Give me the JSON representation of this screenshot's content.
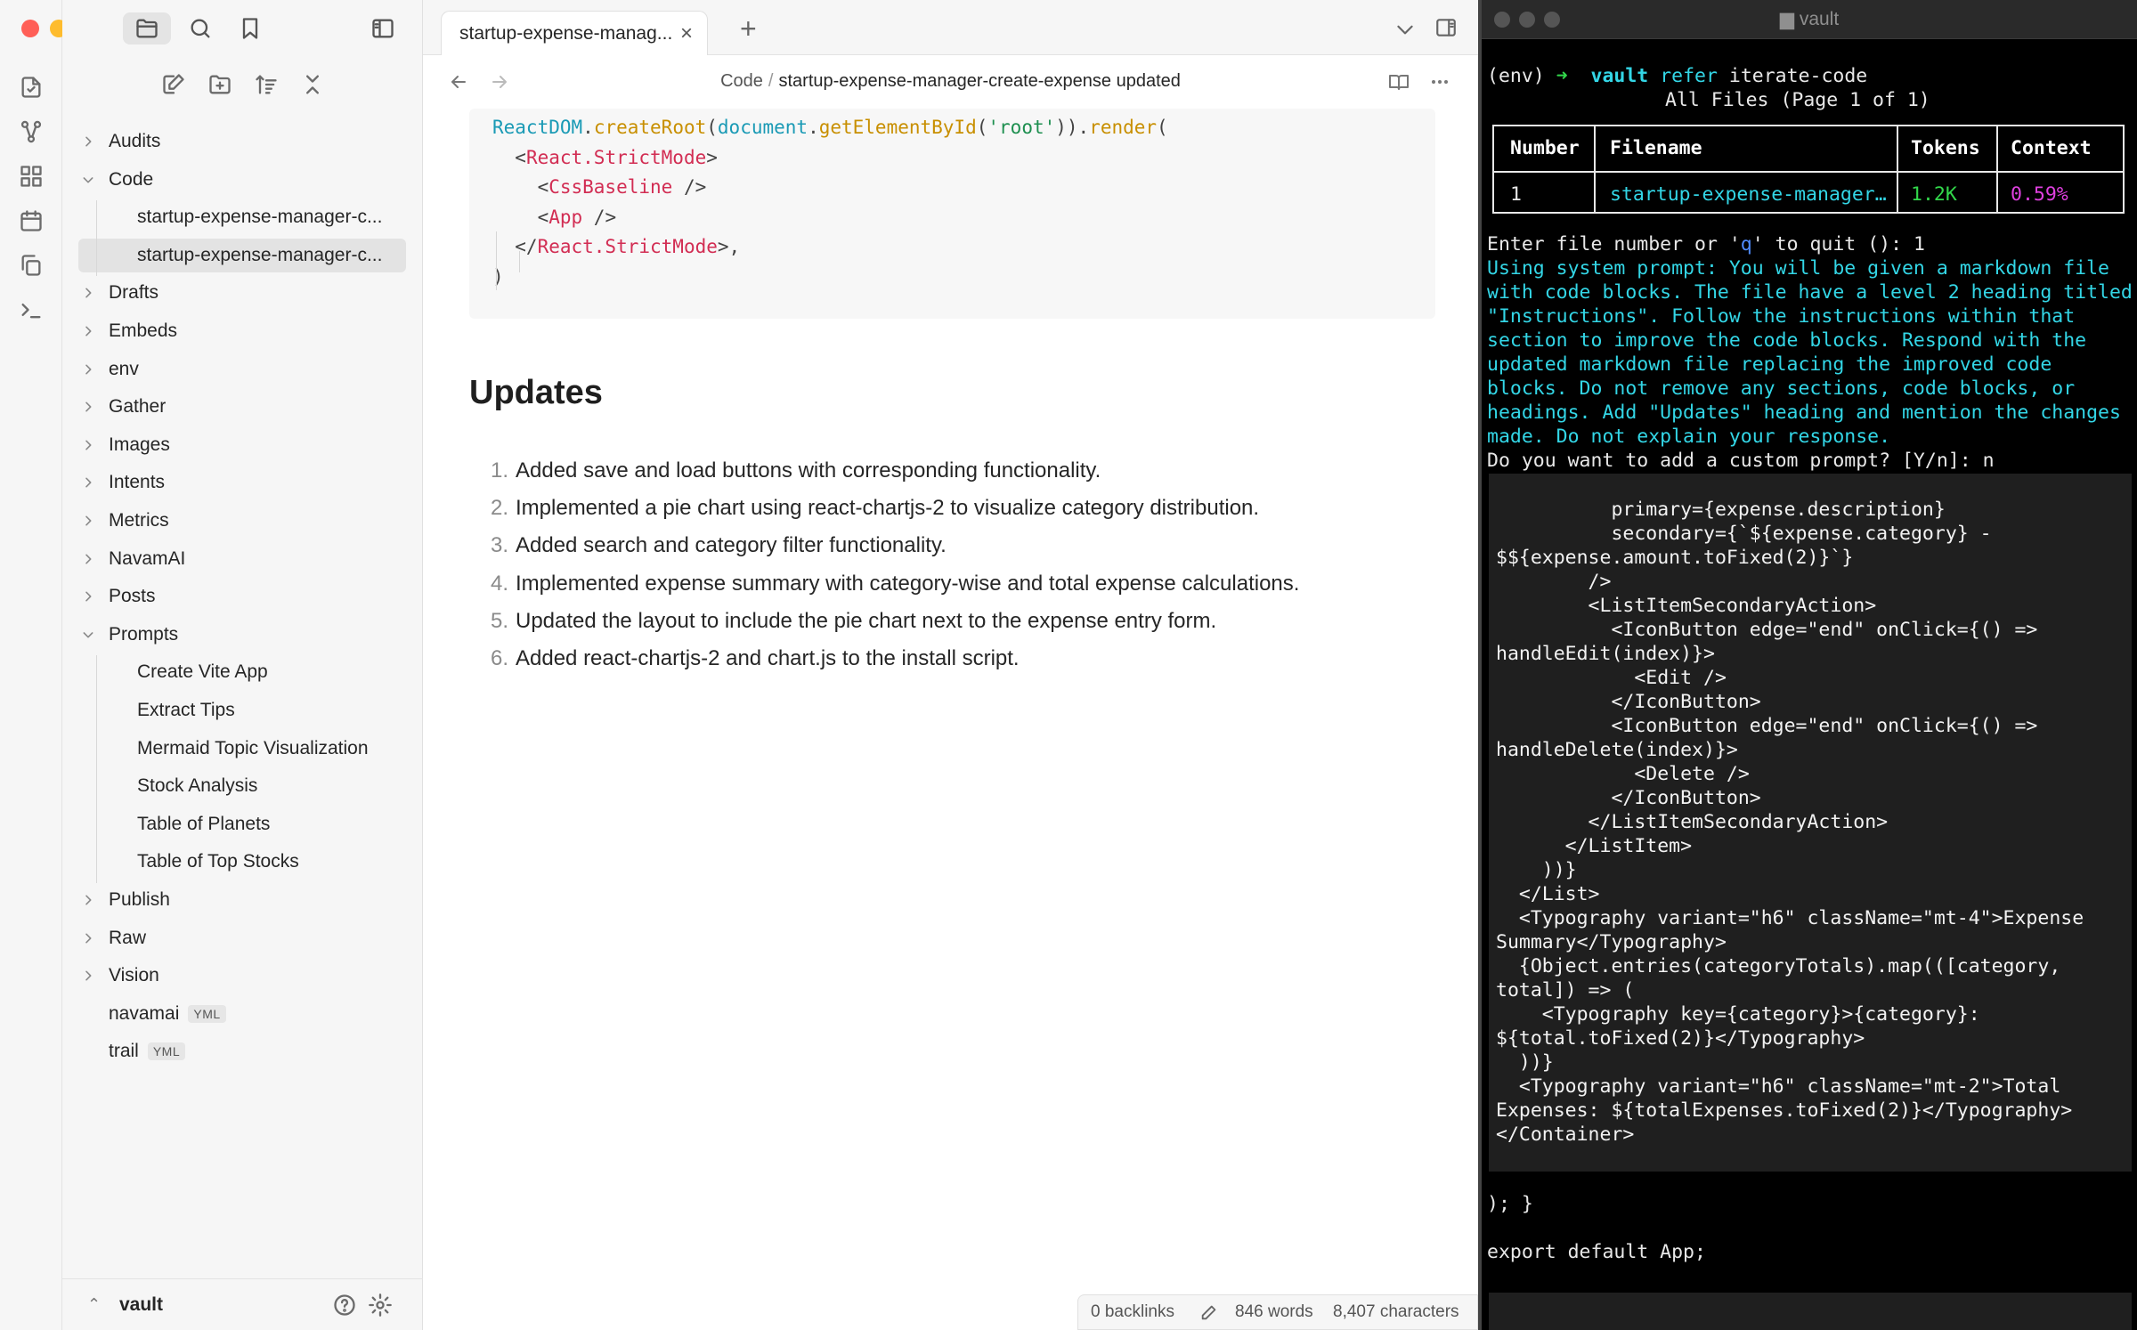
{
  "sidebar": {
    "tree": [
      {
        "label": "Audits",
        "type": "folder",
        "open": false
      },
      {
        "label": "Code",
        "type": "folder",
        "open": true
      },
      {
        "label": "startup-expense-manager-c...",
        "type": "file",
        "child": true
      },
      {
        "label": "startup-expense-manager-c...",
        "type": "file",
        "child": true,
        "selected": true
      },
      {
        "label": "Drafts",
        "type": "folder",
        "open": false
      },
      {
        "label": "Embeds",
        "type": "folder",
        "open": false
      },
      {
        "label": "env",
        "type": "folder",
        "open": false
      },
      {
        "label": "Gather",
        "type": "folder",
        "open": false
      },
      {
        "label": "Images",
        "type": "folder",
        "open": false
      },
      {
        "label": "Intents",
        "type": "folder",
        "open": false
      },
      {
        "label": "Metrics",
        "type": "folder",
        "open": false
      },
      {
        "label": "NavamAI",
        "type": "folder",
        "open": false
      },
      {
        "label": "Posts",
        "type": "folder",
        "open": false
      },
      {
        "label": "Prompts",
        "type": "folder",
        "open": true
      },
      {
        "label": "Create Vite App",
        "type": "file",
        "child": true
      },
      {
        "label": "Extract Tips",
        "type": "file",
        "child": true
      },
      {
        "label": "Mermaid Topic Visualization",
        "type": "file",
        "child": true
      },
      {
        "label": "Stock Analysis",
        "type": "file",
        "child": true
      },
      {
        "label": "Table of Planets",
        "type": "file",
        "child": true
      },
      {
        "label": "Table of Top Stocks",
        "type": "file",
        "child": true
      },
      {
        "label": "Publish",
        "type": "folder",
        "open": false
      },
      {
        "label": "Raw",
        "type": "folder",
        "open": false
      },
      {
        "label": "Vision",
        "type": "folder",
        "open": false
      },
      {
        "label": "navamai",
        "type": "file",
        "badge": "YML"
      },
      {
        "label": "trail",
        "type": "file",
        "badge": "YML"
      }
    ],
    "vault_name": "vault"
  },
  "tab": {
    "title": "startup-expense-manag...",
    "close": "×",
    "new": "+"
  },
  "breadcrumb": {
    "folder": "Code",
    "sep": "/",
    "current": "startup-expense-manager-create-expense updated"
  },
  "code": {
    "l1": {
      "a": "ReactDOM",
      "b": ".",
      "c": "createRoot",
      "d": "(",
      "e": "document",
      "f": ".",
      "g": "getElementById",
      "h": "(",
      "i": "'root'",
      "j": ")).",
      "k": "render",
      "l": "("
    },
    "l2": {
      "a": "  <",
      "b": "React.StrictMode",
      "c": ">"
    },
    "l3": {
      "a": "    <",
      "b": "CssBaseline",
      "c": " />"
    },
    "l4": {
      "a": "    <",
      "b": "App",
      "c": " />"
    },
    "l5": {
      "a": "  </",
      "b": "React.StrictMode",
      "c": ">,"
    },
    "l6": ")"
  },
  "updates": {
    "heading": "Updates",
    "items": [
      "Added save and load buttons with corresponding functionality.",
      "Implemented a pie chart using react-chartjs-2 to visualize category distribution.",
      "Added search and category filter functionality.",
      "Implemented expense summary with category-wise and total expense calculations.",
      "Updated the layout to include the pie chart next to the expense entry form.",
      "Added react-chartjs-2 and chart.js to the install script."
    ],
    "numbers": [
      "1.",
      "2.",
      "3.",
      "4.",
      "5.",
      "6."
    ]
  },
  "status": {
    "backlinks": "0 backlinks",
    "words": "846 words",
    "chars": "8,407 characters"
  },
  "terminal": {
    "title": "vault",
    "prompt_env": "(env)",
    "prompt_arrow": "➜",
    "cmd_vault": "vault",
    "cmd_refer": "refer",
    "cmd_arg": "iterate-code",
    "files_title": "All Files (Page 1 of 1)",
    "table": {
      "headers": [
        "Number",
        "Filename",
        "Tokens",
        "Context"
      ],
      "row": [
        "1",
        "startup-expense-manager…",
        "1.2K",
        "0.59%"
      ]
    },
    "enter_a": "Enter file number or '",
    "enter_q": "q",
    "enter_b": "' to quit ",
    "enter_c": "(): 1",
    "sys_prompt": [
      "Using system prompt: You will be given a markdown file",
      "with code blocks. The file have a level 2 heading titled",
      "\"Instructions\". Follow the instructions within that",
      "section to improve the code blocks. Respond with the",
      "updated markdown file replacing the improved code",
      "blocks. Do not remove any sections, code blocks, or",
      "headings. Add \"Updates\" heading and mention the changes",
      "made. Do not explain your response."
    ],
    "custom_prompt": "Do you want to add a custom prompt? [Y/n]: n",
    "code_lines": [
      "          primary={expense.description}",
      "          secondary={`${expense.category} -",
      "$${expense.amount.toFixed(2)}`}",
      "        />",
      "        <ListItemSecondaryAction>",
      "          <IconButton edge=\"end\" onClick={() =>",
      "handleEdit(index)}>",
      "            <Edit />",
      "          </IconButton>",
      "          <IconButton edge=\"end\" onClick={() =>",
      "handleDelete(index)}>",
      "            <Delete />",
      "          </IconButton>",
      "        </ListItemSecondaryAction>",
      "      </ListItem>",
      "    ))}",
      "  </List>",
      "  <Typography variant=\"h6\" className=\"mt-4\">Expense",
      "Summary</Typography>",
      "  {Object.entries(categoryTotals).map(([category,",
      "total]) => (",
      "    <Typography key={category}>{category}:",
      "${total.toFixed(2)}</Typography>",
      "  ))}",
      "  <Typography variant=\"h6\" className=\"mt-2\">Total",
      "Expenses: ${totalExpenses.toFixed(2)}</Typography>",
      "</Container>"
    ],
    "tail1": "); }",
    "tail2": "export default App;"
  }
}
